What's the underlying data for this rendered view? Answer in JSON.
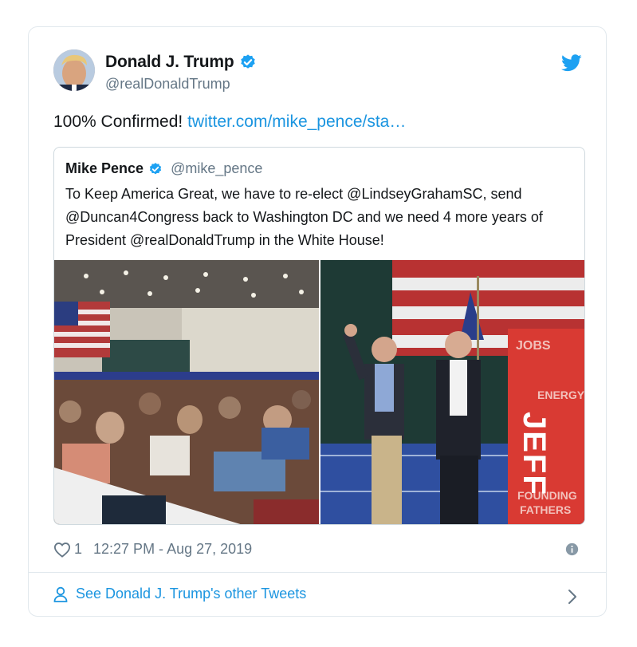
{
  "author": {
    "name": "Donald J. Trump",
    "handle": "@realDonaldTrump",
    "avatar_icon": "avatar"
  },
  "tweet": {
    "text": "100% Confirmed! ",
    "link": "twitter.com/mike_pence/sta…"
  },
  "quoted_tweet": {
    "name": "Mike Pence",
    "handle": "@mike_pence",
    "text": "To Keep America Great, we have to re-elect @LindseyGrahamSC, send @Duncan4Congress back to Washington DC and we need 4 more years of President @realDonaldTrump in the White House!",
    "sign_text": "JEFF",
    "sign_words": [
      "JOBS",
      "ENERGY",
      "FOUNDING",
      "FATHERS"
    ]
  },
  "meta": {
    "likes": "1",
    "timestamp": "12:27 PM - Aug 27, 2019"
  },
  "footer": {
    "label": "See Donald J. Trump's other Tweets"
  },
  "colors": {
    "accent": "#1b95e0",
    "verified": "#1da1f2",
    "secondary_text": "#657786"
  }
}
